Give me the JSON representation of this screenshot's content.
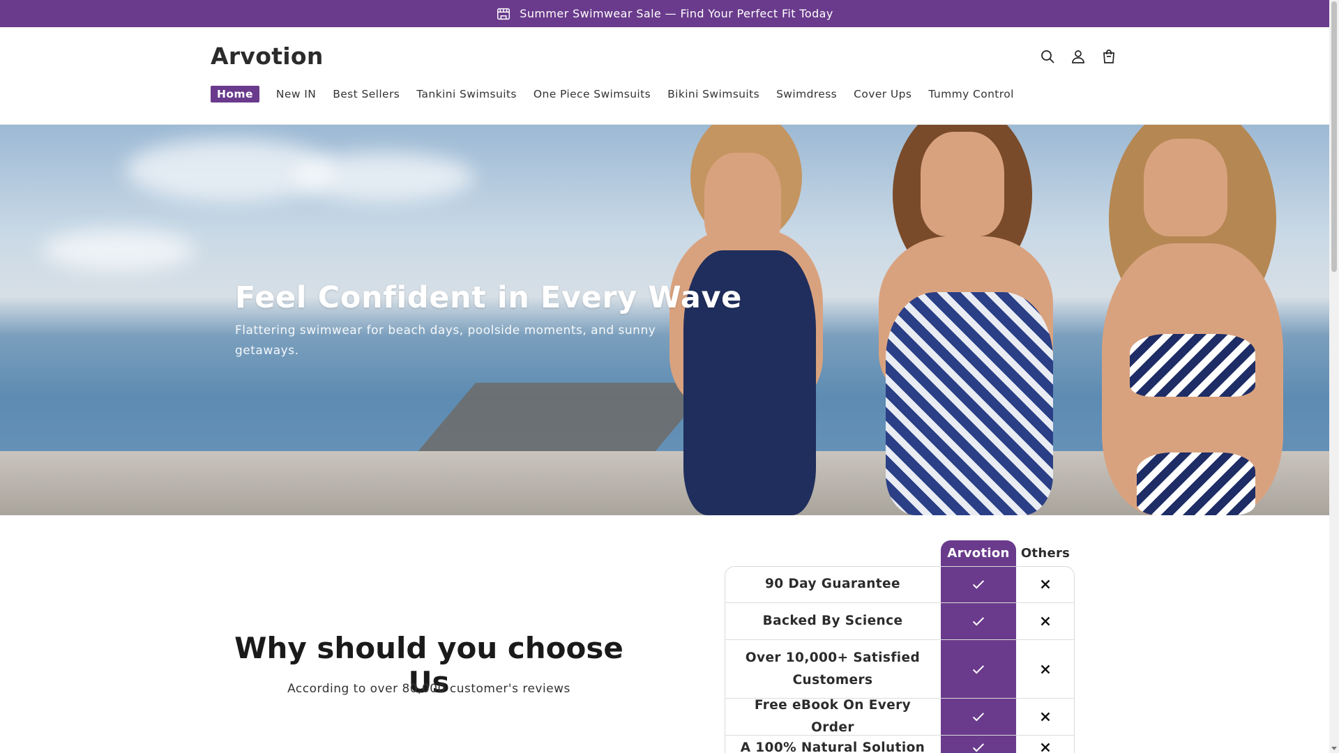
{
  "announcement": {
    "icon": "store-icon",
    "text": "Summer Swimwear Sale — Find Your Perfect Fit Today"
  },
  "header": {
    "logo": "Arvotion",
    "icons": [
      "search-icon",
      "account-icon",
      "cart-icon"
    ]
  },
  "nav": {
    "items": [
      {
        "label": "Home",
        "active": true
      },
      {
        "label": "New IN"
      },
      {
        "label": "Best Sellers"
      },
      {
        "label": "Tankini Swimsuits"
      },
      {
        "label": "One Piece Swimsuits"
      },
      {
        "label": "Bikini Swimsuits"
      },
      {
        "label": "Swimdress"
      },
      {
        "label": "Cover Ups"
      },
      {
        "label": "Tummy Control"
      }
    ]
  },
  "hero": {
    "title": "Feel Confident in Every Wave",
    "subtitle": "Flattering swimwear for beach days, poolside moments, and sunny getaways."
  },
  "why": {
    "title": "Why should you choose Us",
    "subtitle": "According to over 80,000 customer's reviews"
  },
  "comparison": {
    "brand_header": "Arvotion",
    "others_header": "Others",
    "rows": [
      {
        "label": "90 Day Guarantee"
      },
      {
        "label": "Backed By Science"
      },
      {
        "label": "Over 10,000+ Satisfied Customers"
      },
      {
        "label": "Free eBook On Every Order"
      },
      {
        "label": "A 100% Natural Solution"
      }
    ]
  },
  "colors": {
    "brand": "#6a3b8c"
  }
}
